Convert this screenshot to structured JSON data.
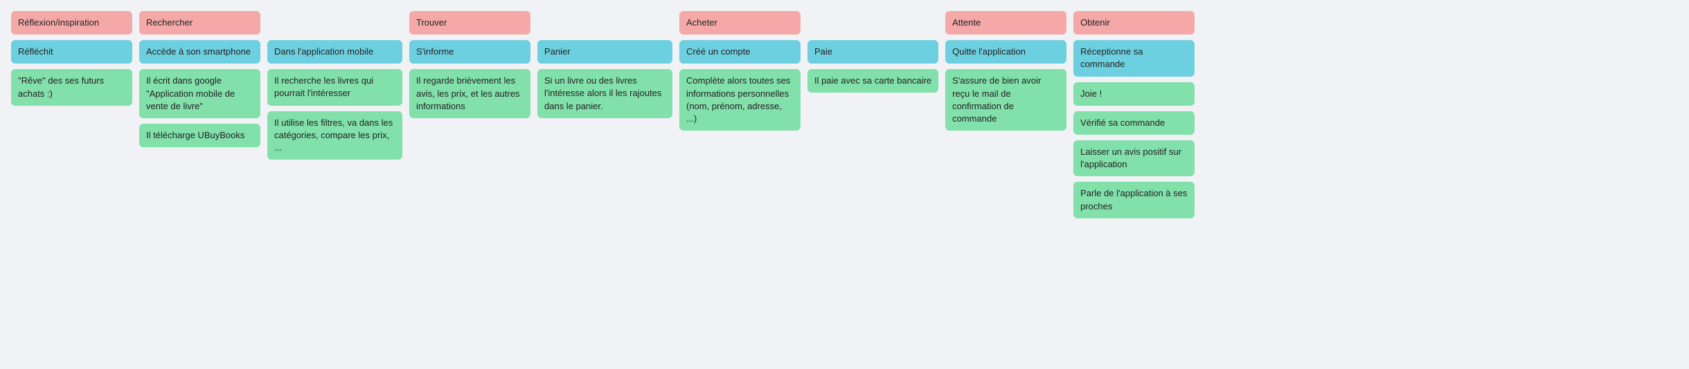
{
  "columns": [
    {
      "id": "reflexion",
      "header": "Réflexion/inspiration",
      "blue": [
        "Réfléchit"
      ],
      "green": [
        "\"Rêve\" des ses futurs achats :)"
      ]
    },
    {
      "id": "rechercher",
      "header": "Rechercher",
      "blue": [
        "Accède à son smartphone"
      ],
      "green": [
        "Il écrit dans google \"Application mobile de vente de livre\"",
        "Il télécharge UBuyBooks"
      ]
    },
    {
      "id": "rechercher2",
      "header": null,
      "blue": [
        "Dans l'application mobile"
      ],
      "green": [
        "Il recherche les livres qui pourrait l'intéresser",
        "Il utilise les filtres, va dans les catégories, compare les prix, ..."
      ]
    },
    {
      "id": "trouver",
      "header": "Trouver",
      "blue": [
        "S'informe"
      ],
      "green": [
        "Il regarde brièvement les avis, les prix, et les autres informations"
      ]
    },
    {
      "id": "trouver2",
      "header": null,
      "blue": [
        "Panier"
      ],
      "green": [
        "Si un livre ou des livres l'intéresse alors il les rajoutes dans le panier."
      ]
    },
    {
      "id": "acheter",
      "header": "Acheter",
      "blue": [
        "Créé un compte"
      ],
      "green": [
        "Complète alors toutes ses informations personnelles (nom, prénom, adresse, ...)"
      ]
    },
    {
      "id": "acheter2",
      "header": null,
      "blue": [
        "Paie"
      ],
      "green": [
        "Il paie avec sa carte bancaire"
      ]
    },
    {
      "id": "attente",
      "header": "Attente",
      "blue": [
        "Quitte l'application"
      ],
      "green": [
        "S'assure de bien avoir reçu le mail de confirmation de commande"
      ]
    },
    {
      "id": "obtenir",
      "header": "Obtenir",
      "blue": [
        "Réceptionne sa commande"
      ],
      "green": [
        "Joie !",
        "Vérifié sa commande",
        "Laisser un avis positif sur l'application",
        "Parle de l'application à ses proches"
      ]
    }
  ]
}
